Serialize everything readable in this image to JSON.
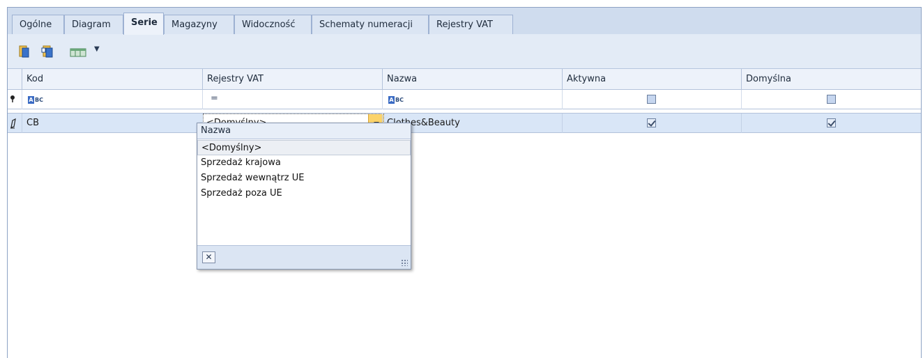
{
  "tabs": [
    {
      "label": "Ogólne",
      "active": false
    },
    {
      "label": "Diagram",
      "active": false
    },
    {
      "label": "Serie",
      "active": true
    },
    {
      "label": "Magazyny",
      "active": false
    },
    {
      "label": "Widoczność",
      "active": false
    },
    {
      "label": "Schematy numeracji",
      "active": false
    },
    {
      "label": "Rejestry VAT",
      "active": false
    }
  ],
  "toolbar": {
    "icons": [
      "add-series-icon",
      "edit-series-icon",
      "view-options-icon",
      "dropdown-arrow-icon"
    ]
  },
  "grid": {
    "columns": [
      "Kod",
      "Rejestry VAT",
      "Nazwa",
      "Aktywna",
      "Domyślna"
    ],
    "filter": {
      "kod_icon": "abc-filter-icon",
      "rejestry_symbol": "=",
      "nazwa_icon": "abc-filter-icon",
      "aktywna_checked": false,
      "domyslna_checked": false
    },
    "rows": [
      {
        "kod": "CB",
        "rejestry": "<Domyślny>",
        "nazwa": "Clothes&Beauty",
        "aktywna": true,
        "domyslna": true
      }
    ]
  },
  "dropdown": {
    "header": "Nazwa",
    "items": [
      "<Domyślny>",
      "Sprzedaż krajowa",
      "Sprzedaż wewnątrz UE",
      "Sprzedaż poza UE"
    ],
    "selected_index": 0,
    "close_label": "✕"
  },
  "colors": {
    "tab_bg": "#dbe5f3",
    "selected_row": "#d9e6f7",
    "combo_button": "#fbd36a"
  }
}
